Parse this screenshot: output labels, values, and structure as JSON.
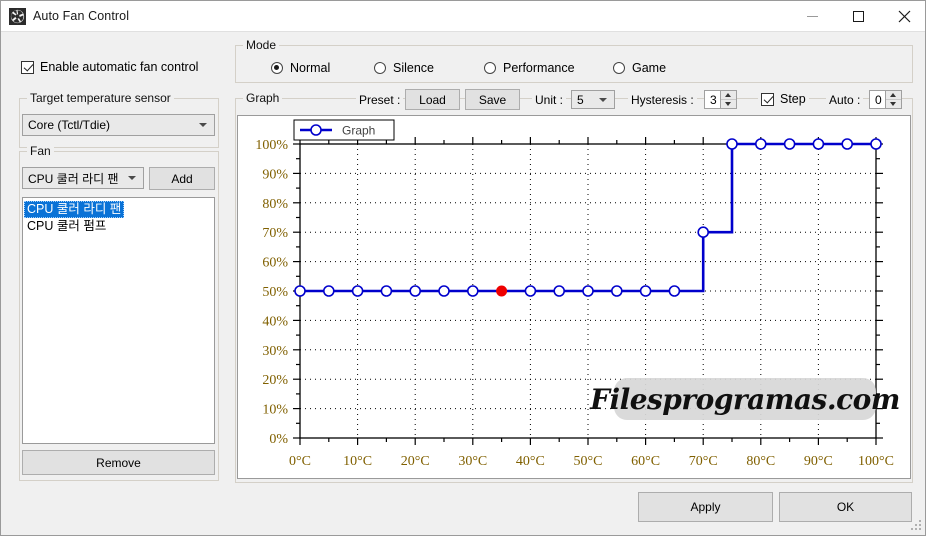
{
  "window": {
    "title": "Auto Fan Control",
    "icon": "fan-icon",
    "minimize_label": "—",
    "maximize_label": "□",
    "close_label": "✕"
  },
  "left_panel": {
    "enable_checkbox": {
      "label": "Enable automatic fan control",
      "checked": true
    },
    "sensor_group": {
      "label": "Target temperature sensor",
      "selected": "Core (Tctl/Tdie)"
    },
    "fan_group": {
      "label": "Fan",
      "selected_fan": "CPU 쿨러 라디 팬",
      "add_label": "Add",
      "list_items": [
        {
          "label": "CPU 쿨러 라디 팬",
          "selected": true
        },
        {
          "label": "CPU 쿨러 펌프",
          "selected": false
        }
      ],
      "remove_label": "Remove"
    }
  },
  "mode": {
    "group_label": "Mode",
    "options": [
      {
        "label": "Normal",
        "selected": true
      },
      {
        "label": "Silence",
        "selected": false
      },
      {
        "label": "Performance",
        "selected": false
      },
      {
        "label": "Game",
        "selected": false
      }
    ]
  },
  "graph_toolbar": {
    "group_label": "Graph",
    "preset_label": "Preset :",
    "load_label": "Load",
    "save_label": "Save",
    "unit_label": "Unit :",
    "unit_value": "5",
    "hysteresis_label": "Hysteresis :",
    "hysteresis_value": "3",
    "step_label": "Step",
    "step_checked": true,
    "auto_label": "Auto :",
    "auto_value": "0"
  },
  "footer": {
    "apply_label": "Apply",
    "ok_label": "OK"
  },
  "watermark": {
    "text": "Filesprogramas.com"
  },
  "colors": {
    "series": "#0000cc",
    "axis_text": "#806000",
    "selected_point": "#ee0000",
    "highlight": "#0a72d6",
    "chart_bg": "#ffffff",
    "window_bg": "#f0f0f0"
  },
  "chart_data": {
    "type": "line",
    "title": "",
    "xlabel": "",
    "ylabel": "",
    "xlim": [
      0,
      100
    ],
    "ylim": [
      0,
      100
    ],
    "grid": true,
    "legend": {
      "position": "top-left",
      "entries": [
        "Graph"
      ]
    },
    "step_interpolation": "post",
    "xtick_labels": [
      "0°C",
      "10°C",
      "20°C",
      "30°C",
      "40°C",
      "50°C",
      "60°C",
      "70°C",
      "80°C",
      "90°C",
      "100°C"
    ],
    "xticks": [
      0,
      10,
      20,
      30,
      40,
      50,
      60,
      70,
      80,
      90,
      100
    ],
    "ytick_labels": [
      "0%",
      "10%",
      "20%",
      "30%",
      "40%",
      "50%",
      "60%",
      "70%",
      "80%",
      "90%",
      "100%"
    ],
    "yticks": [
      0,
      10,
      20,
      30,
      40,
      50,
      60,
      70,
      80,
      90,
      100
    ],
    "minor_tick_step_x": 5,
    "minor_tick_step_y": 5,
    "series": [
      {
        "name": "Graph",
        "color": "#0000cc",
        "marker": "circle-open",
        "x": [
          0,
          5,
          10,
          15,
          20,
          25,
          30,
          35,
          40,
          45,
          50,
          55,
          60,
          65,
          70,
          75,
          80,
          85,
          90,
          95,
          100
        ],
        "y": [
          50,
          50,
          50,
          50,
          50,
          50,
          50,
          50,
          50,
          50,
          50,
          50,
          50,
          50,
          70,
          100,
          100,
          100,
          100,
          100,
          100
        ],
        "selected_index": 7,
        "selected_point": {
          "x": 35,
          "y": 50,
          "color": "#ee0000"
        }
      }
    ]
  }
}
